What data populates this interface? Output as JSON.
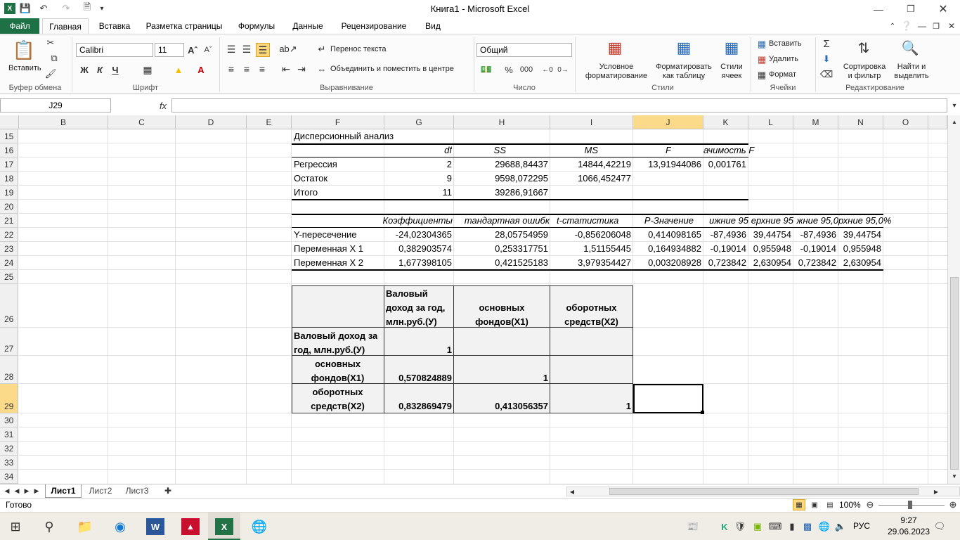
{
  "window": {
    "title": "Книга1  -  Microsoft Excel"
  },
  "ribbon_tabs": [
    "Файл",
    "Главная",
    "Вставка",
    "Разметка страницы",
    "Формулы",
    "Данные",
    "Рецензирование",
    "Вид"
  ],
  "ribbon": {
    "clipboard": {
      "paste": "Вставить",
      "label": "Буфер обмена"
    },
    "font": {
      "name": "Calibri",
      "size": "11",
      "bold": "Ж",
      "italic": "К",
      "underline": "Ч",
      "label": "Шрифт"
    },
    "alignment": {
      "wrap": "Перенос текста",
      "merge": "Объединить и поместить в центре",
      "label": "Выравнивание"
    },
    "number": {
      "format": "Общий",
      "percent": "%",
      "thousands": "000",
      "label": "Число"
    },
    "styles": {
      "conditional": "Условное форматирование",
      "as_table": "Форматировать как таблицу",
      "cell_styles": "Стили ячеек",
      "label": "Стили"
    },
    "cells": {
      "insert": "Вставить",
      "delete": "Удалить",
      "format": "Формат",
      "label": "Ячейки"
    },
    "editing": {
      "sort": "Сортировка и фильтр",
      "find": "Найти и выделить",
      "label": "Редактирование"
    }
  },
  "formula_bar": {
    "name_box": "J29",
    "fx": "fx",
    "content": ""
  },
  "columns": [
    "B",
    "C",
    "D",
    "E",
    "F",
    "G",
    "H",
    "I",
    "J",
    "K",
    "L",
    "M",
    "N",
    "O"
  ],
  "rows": [
    "15",
    "16",
    "17",
    "18",
    "19",
    "20",
    "21",
    "22",
    "23",
    "24",
    "25",
    "26",
    "27",
    "28",
    "29",
    "30",
    "31",
    "32",
    "33",
    "34"
  ],
  "anova": {
    "title": "Дисперсионный анализ",
    "headers": [
      "df",
      "SS",
      "MS",
      "F",
      "ачимость F"
    ],
    "rows": [
      {
        "name": "Регрессия",
        "df": "2",
        "ss": "29688,84437",
        "ms": "14844,42219",
        "f": "13,91944086",
        "sig": "0,001761"
      },
      {
        "name": "Остаток",
        "df": "9",
        "ss": "9598,072295",
        "ms": "1066,452477",
        "f": "",
        "sig": ""
      },
      {
        "name": "Итого",
        "df": "11",
        "ss": "39286,91667",
        "ms": "",
        "f": "",
        "sig": ""
      }
    ]
  },
  "coef": {
    "headers": [
      "Коэффициенты",
      "тандартная ошибк",
      "t-статистика",
      "P-Значение",
      "ижние 95",
      "ерхние 95",
      "жние 95,0",
      "рхние 95,0%"
    ],
    "rows": [
      {
        "name": "Y-пересечение",
        "vals": [
          "-24,02304365",
          "28,05754959",
          "-0,856206048",
          "0,414098165",
          "-87,4936",
          "39,44754",
          "-87,4936",
          "39,44754"
        ]
      },
      {
        "name": "Переменная X 1",
        "vals": [
          "0,382903574",
          "0,253317751",
          "1,51155445",
          "0,164934882",
          "-0,19014",
          "0,955948",
          "-0,19014",
          "0,955948"
        ]
      },
      {
        "name": "Переменная X 2",
        "vals": [
          "1,677398105",
          "0,421525183",
          "3,979354427",
          "0,003208928",
          "0,723842",
          "2,630954",
          "0,723842",
          "2,630954"
        ]
      }
    ]
  },
  "corr": {
    "h1": [
      "Валовый",
      "доход за год,",
      "млн.руб.(У)"
    ],
    "h2": [
      "основных",
      "фондов(X1)"
    ],
    "h3": [
      "оборотных",
      "средств(X2)"
    ],
    "r27": {
      "label": [
        "Валовый доход за",
        "год, млн.руб.(У)"
      ],
      "g": "1"
    },
    "r28": {
      "label": [
        "основных",
        "фондов(X1)"
      ],
      "g": "0,570824889",
      "h": "1"
    },
    "r29": {
      "label": [
        "оборотных",
        "средств(X2)"
      ],
      "g": "0,832869479",
      "h": "0,413056357",
      "i": "1"
    }
  },
  "sheet_tabs": [
    "Лист1",
    "Лист2",
    "Лист3"
  ],
  "status": {
    "ready": "Готово",
    "zoom": "100%"
  },
  "taskbar": {
    "lang": "РУС",
    "time": "9:27",
    "date": "29.06.2023"
  },
  "colors": {
    "file_tab": "#1e7145",
    "excel_green": "#217346",
    "selection": "#000000"
  }
}
